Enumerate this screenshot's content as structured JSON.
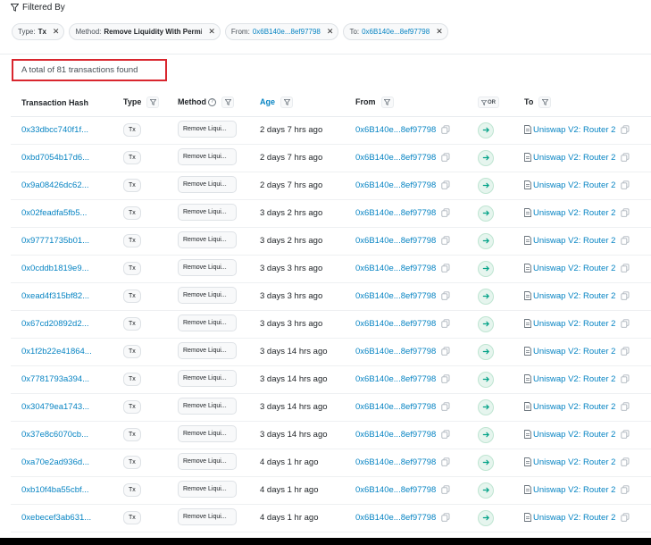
{
  "filter": {
    "header_label": "Filtered By",
    "chips": [
      {
        "key": "Type:",
        "value": "Tx",
        "link": false
      },
      {
        "key": "Method:",
        "value": "Remove Liquidity With Permi",
        "link": false
      },
      {
        "key": "From:",
        "value": "0x6B140e...8ef97798",
        "link": true
      },
      {
        "key": "To:",
        "value": "0x6B140e...8ef97798",
        "link": true
      }
    ]
  },
  "summary": {
    "total_text": "A total of 81 transactions found"
  },
  "table": {
    "headers": {
      "hash": "Transaction Hash",
      "type": "Type",
      "method": "Method",
      "age": "Age",
      "from": "From",
      "or": "OR",
      "to": "To"
    },
    "rows": [
      {
        "hash": "0x33dbcc740f1f...",
        "type": "Tx",
        "method": "Remove Liqui...",
        "age": "2 days 7 hrs ago",
        "from": "0x6B140e...8ef97798",
        "to": "Uniswap V2: Router 2"
      },
      {
        "hash": "0xbd7054b17d6...",
        "type": "Tx",
        "method": "Remove Liqui...",
        "age": "2 days 7 hrs ago",
        "from": "0x6B140e...8ef97798",
        "to": "Uniswap V2: Router 2"
      },
      {
        "hash": "0x9a08426dc62...",
        "type": "Tx",
        "method": "Remove Liqui...",
        "age": "2 days 7 hrs ago",
        "from": "0x6B140e...8ef97798",
        "to": "Uniswap V2: Router 2"
      },
      {
        "hash": "0x02feadfa5fb5...",
        "type": "Tx",
        "method": "Remove Liqui...",
        "age": "3 days 2 hrs ago",
        "from": "0x6B140e...8ef97798",
        "to": "Uniswap V2: Router 2"
      },
      {
        "hash": "0x97771735b01...",
        "type": "Tx",
        "method": "Remove Liqui...",
        "age": "3 days 2 hrs ago",
        "from": "0x6B140e...8ef97798",
        "to": "Uniswap V2: Router 2"
      },
      {
        "hash": "0x0cddb1819e9...",
        "type": "Tx",
        "method": "Remove Liqui...",
        "age": "3 days 3 hrs ago",
        "from": "0x6B140e...8ef97798",
        "to": "Uniswap V2: Router 2"
      },
      {
        "hash": "0xead4f315bf82...",
        "type": "Tx",
        "method": "Remove Liqui...",
        "age": "3 days 3 hrs ago",
        "from": "0x6B140e...8ef97798",
        "to": "Uniswap V2: Router 2"
      },
      {
        "hash": "0x67cd20892d2...",
        "type": "Tx",
        "method": "Remove Liqui...",
        "age": "3 days 3 hrs ago",
        "from": "0x6B140e...8ef97798",
        "to": "Uniswap V2: Router 2"
      },
      {
        "hash": "0x1f2b22e41864...",
        "type": "Tx",
        "method": "Remove Liqui...",
        "age": "3 days 14 hrs ago",
        "from": "0x6B140e...8ef97798",
        "to": "Uniswap V2: Router 2"
      },
      {
        "hash": "0x7781793a394...",
        "type": "Tx",
        "method": "Remove Liqui...",
        "age": "3 days 14 hrs ago",
        "from": "0x6B140e...8ef97798",
        "to": "Uniswap V2: Router 2"
      },
      {
        "hash": "0x30479ea1743...",
        "type": "Tx",
        "method": "Remove Liqui...",
        "age": "3 days 14 hrs ago",
        "from": "0x6B140e...8ef97798",
        "to": "Uniswap V2: Router 2"
      },
      {
        "hash": "0x37e8c6070cb...",
        "type": "Tx",
        "method": "Remove Liqui...",
        "age": "3 days 14 hrs ago",
        "from": "0x6B140e...8ef97798",
        "to": "Uniswap V2: Router 2"
      },
      {
        "hash": "0xa70e2ad936d...",
        "type": "Tx",
        "method": "Remove Liqui...",
        "age": "4 days 1 hr ago",
        "from": "0x6B140e...8ef97798",
        "to": "Uniswap V2: Router 2"
      },
      {
        "hash": "0xb10f4ba55cbf...",
        "type": "Tx",
        "method": "Remove Liqui...",
        "age": "4 days 1 hr ago",
        "from": "0x6B140e...8ef97798",
        "to": "Uniswap V2: Router 2"
      },
      {
        "hash": "0xebecef3ab631...",
        "type": "Tx",
        "method": "Remove Liqui...",
        "age": "4 days 1 hr ago",
        "from": "0x6B140e...8ef97798",
        "to": "Uniswap V2: Router 2"
      }
    ]
  },
  "icons": {
    "filter": "funnel-icon",
    "info": "info-icon",
    "copy": "copy-icon",
    "direction": "arrow-right-icon",
    "contract": "document-icon",
    "remove": "close-icon"
  },
  "colors": {
    "link": "#0784c3",
    "highlight_border": "#d9262e",
    "direction_badge_bg": "#e6f5ee",
    "direction_arrow": "#00a186"
  }
}
